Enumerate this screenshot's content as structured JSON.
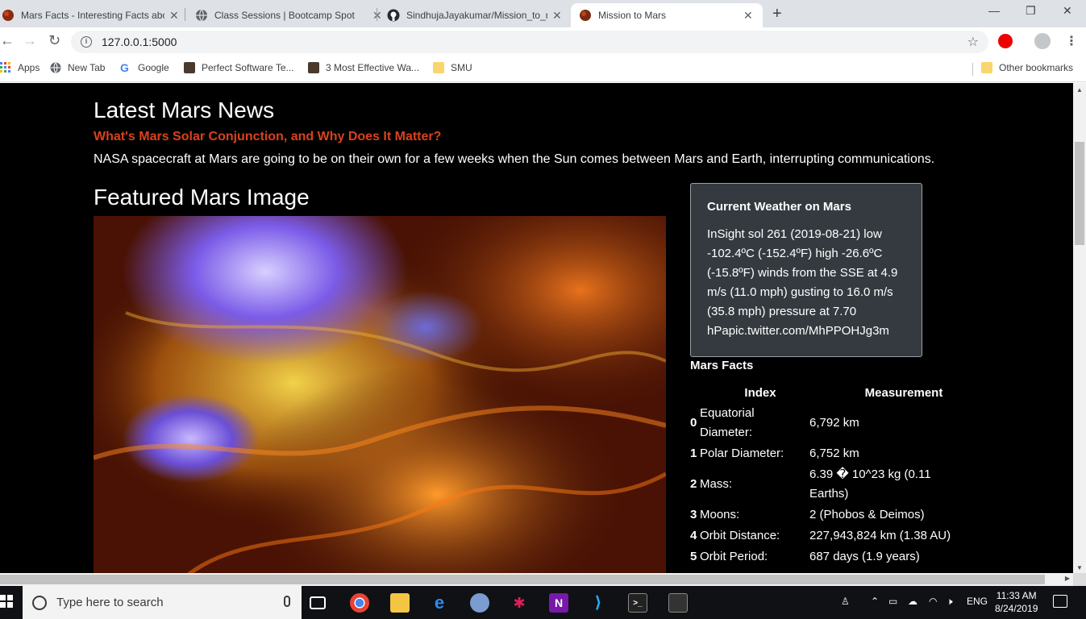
{
  "browser": {
    "tabs": [
      {
        "title": "Mars Facts - Interesting Facts abo",
        "icon": "mars-icon",
        "active": false
      },
      {
        "title": "Class Sessions | Bootcamp Spot",
        "icon": "globe-icon",
        "active": false
      },
      {
        "title": "SindhujaJayakumar/Mission_to_m",
        "icon": "github-icon",
        "active": false
      },
      {
        "title": "Mission to Mars",
        "icon": "mars-icon",
        "active": true
      }
    ],
    "new_tab": "+",
    "url": "127.0.0.1:5000",
    "bookmarks": [
      "Apps",
      "New Tab",
      "Google",
      "Perfect Software Te...",
      "3 Most Effective Wa...",
      "SMU"
    ],
    "other_bookmarks": "Other bookmarks"
  },
  "page": {
    "news_section_title": "Latest Mars News",
    "news_headline": "What's Mars Solar Conjunction, and Why Does It Matter?",
    "news_paragraph": "NASA spacecraft at Mars are going to be on their own for a few weeks when the Sun comes between Mars and Earth, interrupting communications.",
    "featured_title": "Featured Mars Image",
    "weather": {
      "title": "Current Weather on Mars",
      "text": "InSight sol 261 (2019-08-21) low -102.4ºC (-152.4ºF) high -26.6ºC (-15.8ºF) winds from the SSE at 4.9 m/s (11.0 mph) gusting to 16.0 m/s (35.8 mph) pressure at 7.70 hPapic.twitter.com/MhPPOHJg3m"
    },
    "facts": {
      "title": "Mars Facts",
      "headers": [
        "Index",
        "Measurement"
      ],
      "rows": [
        {
          "index": "0",
          "label": "Equatorial Diameter:",
          "value": "6,792 km"
        },
        {
          "index": "1",
          "label": "Polar Diameter:",
          "value": "6,752 km"
        },
        {
          "index": "2",
          "label": "Mass:",
          "value": "6.39 � 10^23 kg (0.11 Earths)"
        },
        {
          "index": "3",
          "label": "Moons:",
          "value": "2 (Phobos & Deimos)"
        },
        {
          "index": "4",
          "label": "Orbit Distance:",
          "value": "227,943,824 km (1.38 AU)"
        },
        {
          "index": "5",
          "label": "Orbit Period:",
          "value": "687 days (1.9 years)"
        }
      ]
    }
  },
  "taskbar": {
    "search_placeholder": "Type here to search",
    "language": "ENG",
    "time": "11:33 AM",
    "date": "8/24/2019"
  }
}
